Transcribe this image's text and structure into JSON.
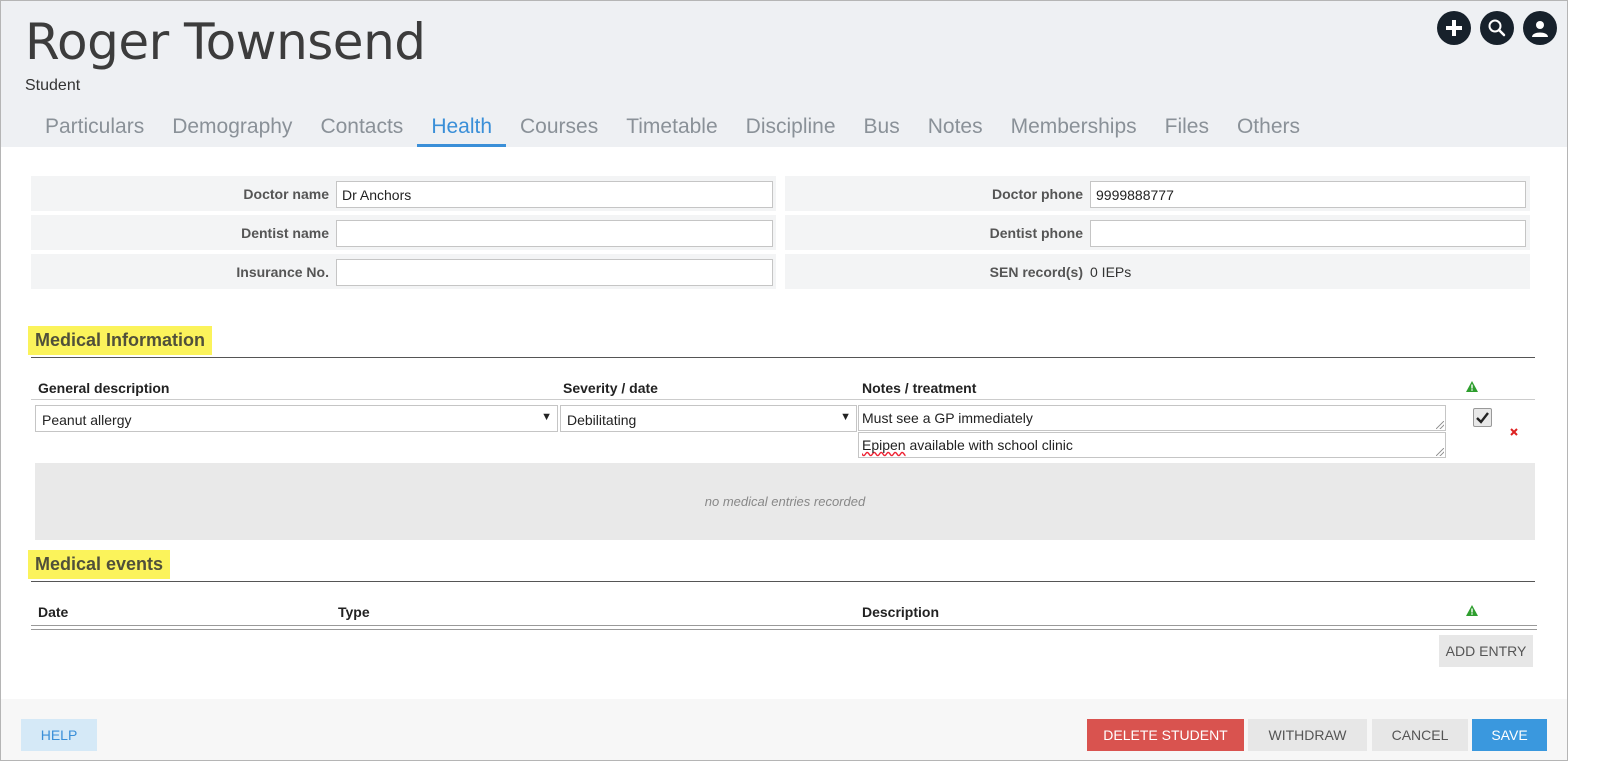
{
  "header": {
    "name": "Roger Townsend",
    "role": "Student",
    "icons": [
      "plus-icon",
      "search-icon",
      "user-icon"
    ]
  },
  "tabs": [
    {
      "label": "Particulars"
    },
    {
      "label": "Demography"
    },
    {
      "label": "Contacts"
    },
    {
      "label": "Health",
      "active": true
    },
    {
      "label": "Courses"
    },
    {
      "label": "Timetable"
    },
    {
      "label": "Discipline"
    },
    {
      "label": "Bus"
    },
    {
      "label": "Notes"
    },
    {
      "label": "Memberships"
    },
    {
      "label": "Files"
    },
    {
      "label": "Others"
    }
  ],
  "form": {
    "doctor_name_label": "Doctor name",
    "doctor_name_value": "Dr Anchors",
    "doctor_phone_label": "Doctor phone",
    "doctor_phone_value": "9999888777",
    "dentist_name_label": "Dentist name",
    "dentist_name_value": "",
    "dentist_phone_label": "Dentist phone",
    "dentist_phone_value": "",
    "insurance_label": "Insurance No.",
    "insurance_value": "",
    "sen_label": "SEN record(s)",
    "sen_value": "0 IEPs"
  },
  "medical_info": {
    "title": "Medical Information",
    "col_description": "General description",
    "col_severity": "Severity / date",
    "col_notes": "Notes / treatment",
    "entry": {
      "description": "Peanut allergy",
      "severity": "Debilitating",
      "notes": "Must see a GP immediately",
      "treatment_word1": "Epipen",
      "treatment_rest": " available with school clinic",
      "checked": true
    },
    "empty_message": "no medical entries recorded"
  },
  "medical_events": {
    "title": "Medical events",
    "col_date": "Date",
    "col_type": "Type",
    "col_description": "Description",
    "add_entry": "ADD ENTRY"
  },
  "footer": {
    "help": "HELP",
    "delete": "DELETE STUDENT",
    "withdraw": "WITHDRAW",
    "cancel": "CANCEL",
    "save": "SAVE"
  },
  "colors": {
    "accent": "#3a8fd8",
    "danger": "#d9534f",
    "highlight": "#fbf35b",
    "warning_green": "#2e9e2e"
  }
}
